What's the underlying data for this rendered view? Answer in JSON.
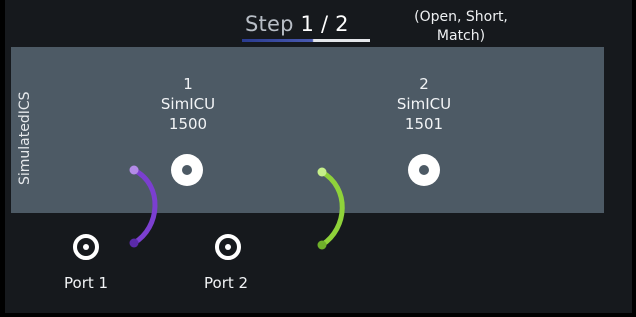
{
  "step": {
    "label": "Step",
    "current": "1",
    "separator": "/",
    "total": "2"
  },
  "hint": "(Open, Short,\nMatch)",
  "panel": {
    "vertical_label": "SimulatedICS",
    "sims": [
      {
        "index": "1",
        "name": "SimICU",
        "id": "1500"
      },
      {
        "index": "2",
        "name": "SimICU",
        "id": "1501"
      }
    ]
  },
  "ports": [
    {
      "label": "Port 1"
    },
    {
      "label": "Port 2"
    }
  ],
  "colors": {
    "cable_1": "#7b3fd0",
    "cable_2": "#8fd23a",
    "panel": "#4d5a65"
  }
}
